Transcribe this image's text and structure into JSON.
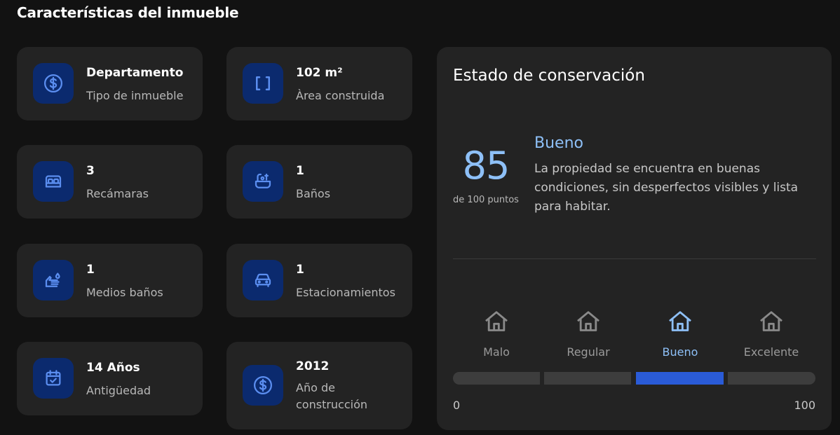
{
  "section": {
    "title": "Características del inmueble"
  },
  "features": [
    {
      "value": "Departamento",
      "label": "Tipo de inmueble",
      "icon": "dollar-circle-icon"
    },
    {
      "value": "102 m²",
      "label": "Àrea construida",
      "icon": "brackets-icon"
    },
    {
      "value": "3",
      "label": "Recámaras",
      "icon": "bed-icon"
    },
    {
      "value": "1",
      "label": "Baños",
      "icon": "bathtub-icon"
    },
    {
      "value": "1",
      "label": "Medios baños",
      "icon": "hand-wash-icon"
    },
    {
      "value": "1",
      "label": "Estacionamientos",
      "icon": "car-icon"
    },
    {
      "value": "14 Años",
      "label": "Antigüedad",
      "icon": "calendar-check-icon"
    },
    {
      "value": "2012",
      "label": "Año de construcción",
      "icon": "dollar-circle-icon"
    }
  ],
  "conservation": {
    "title": "Estado de conservación",
    "score": "85",
    "score_caption": "de 100 puntos",
    "condition": "Bueno",
    "description": "La propiedad se encuentra en buenas condiciones, sin desperfectos visibles y lista para habitar.",
    "levels": [
      {
        "label": "Malo",
        "icon": "house-icon",
        "active": false
      },
      {
        "label": "Regular",
        "icon": "house-icon",
        "active": false
      },
      {
        "label": "Bueno",
        "icon": "house-icon",
        "active": true
      },
      {
        "label": "Excelente",
        "icon": "house-icon",
        "active": false
      }
    ],
    "scale_min": "0",
    "scale_max": "100",
    "active_segment": 2
  },
  "colors": {
    "background": "#121212",
    "card": "#232323",
    "icon_bg": "#0b2a6e",
    "icon_stroke": "#5b8ef0",
    "accent": "#8ec0f7",
    "active_bar": "#2a5bd7",
    "inactive_bar": "#3d3d3d"
  }
}
